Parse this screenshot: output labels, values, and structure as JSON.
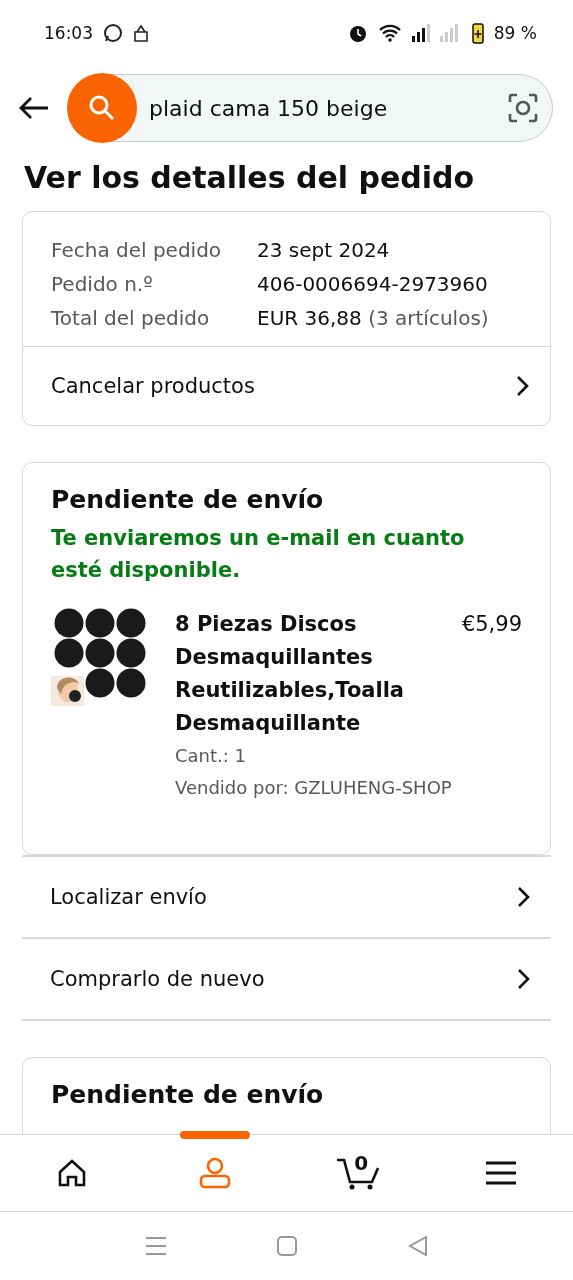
{
  "status_bar": {
    "time": "16:03",
    "battery": "89 %"
  },
  "search": {
    "value": "plaid cama 150 beige"
  },
  "title": "Ver los detalles del pedido",
  "order_summary": {
    "rows": [
      {
        "label": "Fecha del pedido",
        "value": "23 sept 2024"
      },
      {
        "label": "Pedido n.º",
        "value": "406-0006694-2973960"
      },
      {
        "label": "Total del pedido",
        "value": "EUR 36,88",
        "note": "(3 artículos)"
      }
    ],
    "action": "Cancelar productos"
  },
  "shipments": [
    {
      "heading": "Pendiente de envío",
      "message": "Te enviaremos un e-mail en cuanto esté disponible.",
      "item": {
        "kind": "picture",
        "name": "8 Piezas Discos Desmaquillantes Reutilizables,Toalla Desmaquillante",
        "price": "€5,99",
        "quantity": "Cant.: 1",
        "seller": "Vendido por: GZLUHENG-SHOP"
      },
      "actions": [
        "Localizar envío",
        "Comprarlo de nuevo"
      ]
    },
    {
      "heading": "Pendiente de envío"
    }
  ],
  "bottom_nav": [
    {
      "kind": "home",
      "selected": false
    },
    {
      "kind": "account",
      "selected": true
    },
    {
      "kind": "cart",
      "count": "0",
      "selected": false
    },
    {
      "kind": "menu",
      "selected": false
    }
  ]
}
